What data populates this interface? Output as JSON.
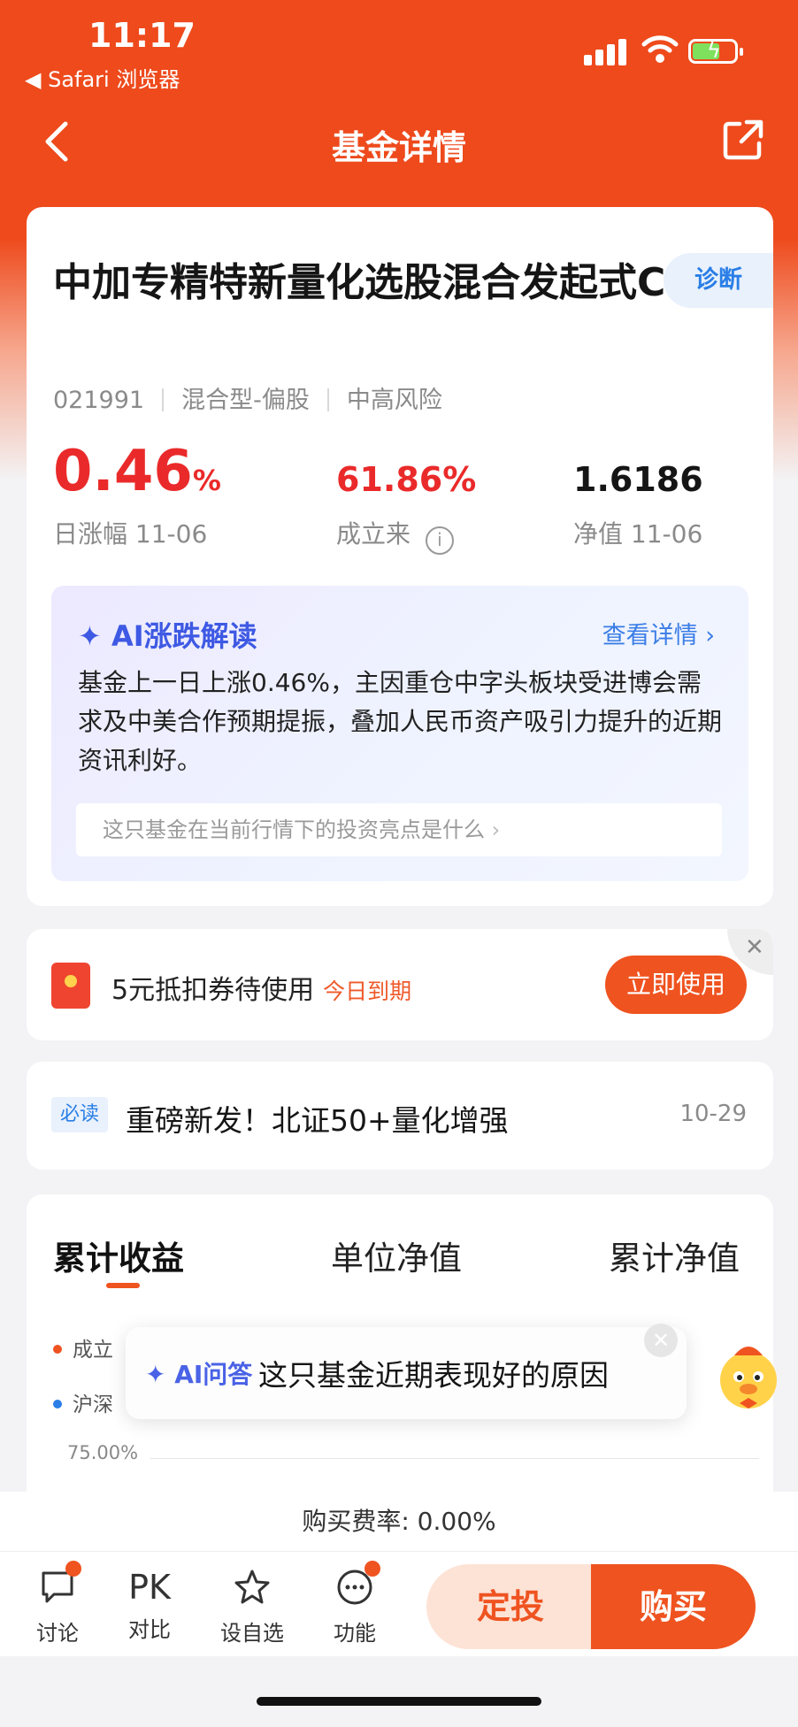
{
  "status_bar": {
    "time": "11:17",
    "back_app": "◀ Safari 浏览器"
  },
  "nav": {
    "title": "基金详情"
  },
  "fund": {
    "name": "中加专精特新量化选股混合发起式C",
    "diagnose_label": "诊断",
    "code": "021991",
    "type": "混合型-偏股",
    "risk": "中高风险",
    "daily_change": "0.46",
    "daily_change_unit": "%",
    "daily_change_label": "日涨幅 11-06",
    "since_inception": "61.86%",
    "since_inception_label": "成立来",
    "nav_value": "1.6186",
    "nav_label": "净值 11-06"
  },
  "ai_analysis": {
    "title": "AI涨跌解读",
    "more": "查看详情",
    "text": "基金上一日上涨0.46%，主因重仓中字头板块受进博会需求及中美合作预期提振，叠加人民币资产吸引力提升的近期资讯利好。",
    "question": "这只基金在当前行情下的投资亮点是什么"
  },
  "coupon": {
    "text": "5元抵扣券待使用",
    "expiry": "今日到期",
    "action": "立即使用",
    "close": "✕"
  },
  "news": {
    "tag": "必读",
    "title": "重磅新发！北证50+量化增强",
    "date": "10-29"
  },
  "returns": {
    "tabs": [
      "累计收益",
      "单位净值",
      "累计净值"
    ],
    "legend": [
      {
        "label": "成立",
        "color": "#ef5320"
      },
      {
        "label": "沪深",
        "color": "#2a7ee6"
      }
    ],
    "y_tick": "75.00%"
  },
  "ai_popup": {
    "label": "AI问答",
    "question": "这只基金近期表现好的原因",
    "close": "✕"
  },
  "fee": "购买费率: 0.00%",
  "bottom_bar": {
    "items": [
      "讨论",
      "对比",
      "设自选",
      "功能"
    ],
    "pk_text": "PK",
    "plan": "定投",
    "buy": "购买"
  },
  "colors": {
    "brand": "#ef5320",
    "up_red": "#ea2a2a",
    "ai_blue": "#3e59e3",
    "link_blue": "#2a7ee6"
  }
}
